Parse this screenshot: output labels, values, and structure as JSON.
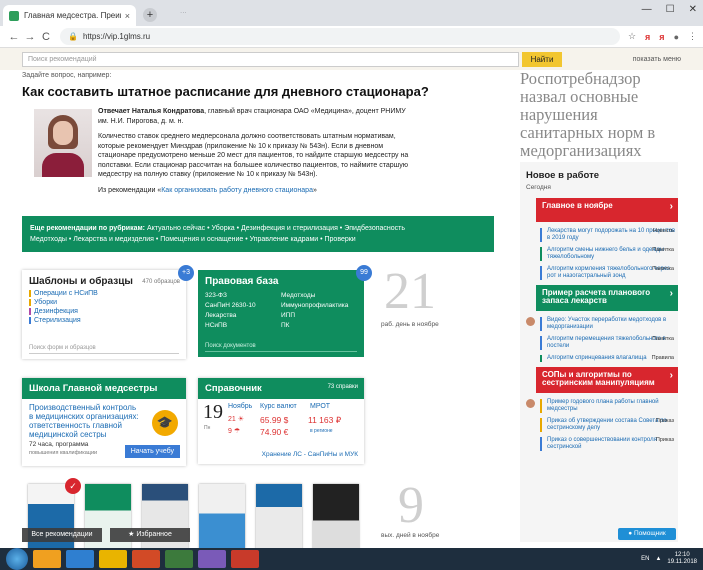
{
  "browser": {
    "tab_title": "Главная медсестра. Преимуществ",
    "tab_close": "×",
    "new_tab": "+",
    "blurred_tabs": "...",
    "url": "https://vip.1glms.ru",
    "back": "←",
    "forward": "→",
    "reload": "C",
    "star": "☆",
    "ext1": "я",
    "ext2": "я",
    "menu": "⋮",
    "window_min": "—",
    "window_max": "☐",
    "window_close": "✕"
  },
  "topbar": {
    "search_placeholder": "Поиск рекомендаций",
    "find_button": "Найти",
    "show_menu": "показать меню"
  },
  "question": {
    "ask_prompt": "Задайте вопрос, например:",
    "title": "Как составить штатное расписание для дневного стационара?",
    "author_line_bold": "Отвечает Наталья Кондратова",
    "author_line_rest": ", главный врач стационара ОАО «Медицина», доцент РНИМУ им. Н.И. Пирогова, д. м. н.",
    "body": "Количество ставок среднего медперсонала должно соответствовать штатным нормативам, которые рекомендует Минздрав (приложение № 10 к приказу № 543н). Если в дневном стационаре предусмотрено меньше 20 мест для пациентов, то найдите старшую медсестру на полставки. Если стационар рассчитан на большее количество пациентов, то наймите старшую медсестру на полную ставку (приложение № 10 к приказу № 543н).",
    "source_prefix": "Из рекомендации «",
    "source_link": "Как организовать работу дневного стационара",
    "source_suffix": "»"
  },
  "rubrics": {
    "label": "Еще рекомендации по рубрикам:",
    "line1": "Актуально сейчас • Уборка • Дезинфекция и стерилизация • Эпидбезопасность",
    "line2": "Медотходы • Лекарства и медизделия • Помещения и оснащение • Управление кадрами • Проверки"
  },
  "templates": {
    "title": "Шаблоны и образцы",
    "count": "470 образцов",
    "badge": "+3",
    "items": [
      "Операции с НСиПВ",
      "Уборки",
      "Дезинфекция",
      "Стерилизация"
    ],
    "search": "Поиск форм и образцов"
  },
  "lawbase": {
    "title": "Правовая база",
    "badge": "99",
    "items": [
      "323-ФЗ",
      "Медотходы",
      "СанПиН 2630-10",
      "Иммунопрофилактика",
      "Лекарства",
      "ИПП",
      "НСиПВ",
      "ПК"
    ],
    "search": "Поиск документов"
  },
  "workdays": {
    "number": "21",
    "caption": "раб. день в ноябре"
  },
  "school": {
    "title": "Школа Главной медсестры",
    "desc": "Производственный контроль в медицинских организациях: ответственность главной медицинской сестры",
    "hours": "72 часа, программа",
    "hours2": "повышения квалификации",
    "start": "Начать учебу",
    "hat_icon": "🎓"
  },
  "reference": {
    "title": "Справочник",
    "count": "73 справки",
    "day": "19",
    "dayname": "Пн",
    "month": "Ноябрь",
    "temp1": "21 ☀",
    "temp2": "9 ☂",
    "currency_label": "Курс валют",
    "usd": "65.99 $",
    "eur": "74.90 €",
    "mrot_label": "МРОТ",
    "mrot_value": "11 163 ₽",
    "mrot_note": "в регионе",
    "link": "Хранение ЛС - СанПиНы и МУК"
  },
  "holidays": {
    "number": "9",
    "caption": "вых. дней в ноябре"
  },
  "overlay": {
    "all_recommendations": "Все рекомендации",
    "favorites": "★ Избранное",
    "check": "✓"
  },
  "quote": "Роспотребнадзор назвал основные нарушения санитарных норм в медорганизациях",
  "news": {
    "title": "Новое в работе",
    "today": "Сегодня",
    "banner1": "Главное в ноябре",
    "banner2": "Пример расчета планового запаса лекарств",
    "banner3": "СОПы и алгоритмы по сестринским манипуляциям",
    "items": [
      {
        "text": "Лекарства могут подорожать на 10 процентов в 2019 году",
        "tag": "Новость"
      },
      {
        "text": "Алгоритм смены нижнего белья и одежды тяжелобольному",
        "tag": "Памятка"
      },
      {
        "text": "Алгоритм кормления тяжелобольного через рот и назогастральный зонд",
        "tag": "Памятка"
      },
      {
        "text": "Видео: Участок переработки медотходов в медорганизации",
        "tag": ""
      },
      {
        "text": "Алгоритм перемещения тяжелобольного в постели",
        "tag": "Памятка"
      },
      {
        "text": "Алгоритм спринцевания влагалища",
        "tag": "Правила"
      },
      {
        "text": "Пример годового плана работы главной медсестры",
        "tag": ""
      },
      {
        "text": "Приказ об утверждении состава Совета по сестринскому делу",
        "tag": "Приказ"
      },
      {
        "text": "Приказ о совершенствовании контроля сестринской",
        "tag": "Приказ"
      }
    ],
    "helper": "● Помощник"
  },
  "taskbar": {
    "lang": "EN",
    "time": "12:10",
    "date": "19.11.2018"
  },
  "colors": {
    "brand_green": "#0f8d5e",
    "accent_yellow": "#f2c630",
    "link_blue": "#1a6bb3",
    "alert_red": "#d8262e"
  }
}
